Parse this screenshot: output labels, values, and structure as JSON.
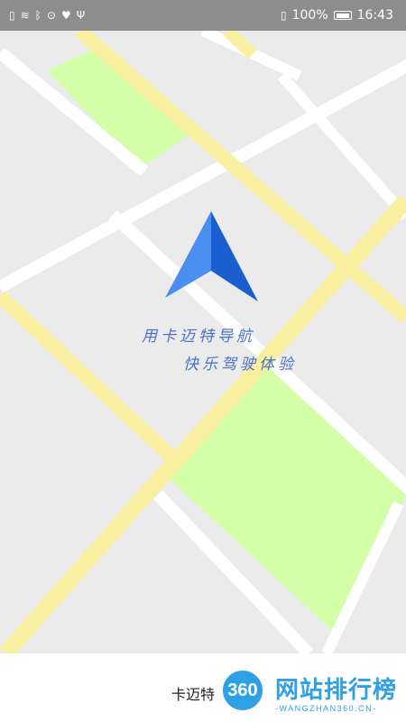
{
  "status_bar": {
    "battery": "100%",
    "time": "16:43",
    "icons": [
      "sim-icon",
      "wifi-icon",
      "bluetooth-icon",
      "location-icon",
      "heart-icon",
      "usb-icon",
      "vibrate-icon",
      "battery-icon"
    ]
  },
  "splash": {
    "tagline_1": "用卡迈特导航",
    "tagline_2": "快乐驾驶体验"
  },
  "bottom": {
    "app_name": "卡迈特"
  },
  "watermark": {
    "badge": "360",
    "title": "网站排行榜",
    "subtitle": "-WANGZHAN360.CN-"
  },
  "colors": {
    "map_bg": "#ebebeb",
    "road_white": "#ffffff",
    "road_yellow": "#f8f0a0",
    "park_green": "#d3ffa8",
    "arrow_light": "#4a8ff0",
    "arrow_dark": "#1a5fd0",
    "status_bar": "#8d8d8d",
    "watermark_blue": "#2ea0e6"
  }
}
